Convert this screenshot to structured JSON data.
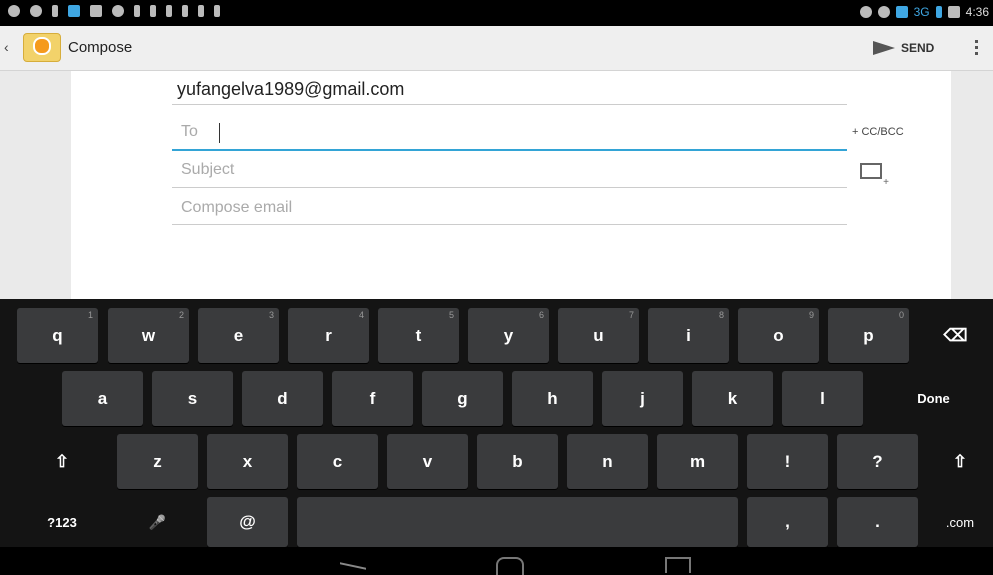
{
  "app": {
    "title": "Compose",
    "send_label": "SEND"
  },
  "status": {
    "network": "3G",
    "time": "4:36"
  },
  "compose": {
    "from": "yufangelva1989@gmail.com",
    "to_placeholder": "To",
    "subject_placeholder": "Subject",
    "body_placeholder": "Compose email",
    "ccbcc_label": "+ CC/BCC"
  },
  "keyboard": {
    "row1": [
      {
        "label": "q",
        "hint": "1"
      },
      {
        "label": "w",
        "hint": "2"
      },
      {
        "label": "e",
        "hint": "3"
      },
      {
        "label": "r",
        "hint": "4"
      },
      {
        "label": "t",
        "hint": "5"
      },
      {
        "label": "y",
        "hint": "6"
      },
      {
        "label": "u",
        "hint": "7"
      },
      {
        "label": "i",
        "hint": "8"
      },
      {
        "label": "o",
        "hint": "9"
      },
      {
        "label": "p",
        "hint": "0"
      }
    ],
    "row2": [
      "a",
      "s",
      "d",
      "f",
      "g",
      "h",
      "j",
      "k",
      "l"
    ],
    "row3": [
      "z",
      "x",
      "c",
      "v",
      "b",
      "n",
      "m",
      "!",
      "?"
    ],
    "done_label": "Done",
    "backspace_label": "⌫",
    "shift_label": "⇧",
    "symbols_label": "?123",
    "mic_label": "🎤",
    "at_label": "@",
    "comma_label": ",",
    "period_label": ".",
    "dotcom_label": ".com"
  },
  "icons": {
    "back": "chevron-left-icon",
    "app": "email-app-icon",
    "send": "send-icon",
    "overflow": "overflow-menu-icon",
    "attach": "attach-image-icon"
  }
}
